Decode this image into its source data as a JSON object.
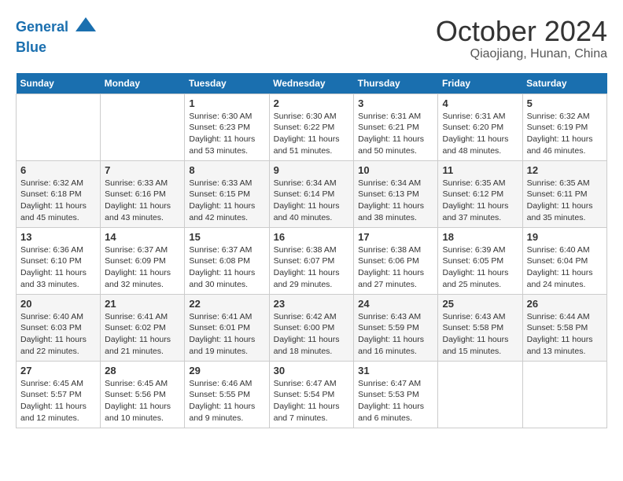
{
  "header": {
    "logo_line1": "General",
    "logo_line2": "Blue",
    "month": "October 2024",
    "location": "Qiaojiang, Hunan, China"
  },
  "days_of_week": [
    "Sunday",
    "Monday",
    "Tuesday",
    "Wednesday",
    "Thursday",
    "Friday",
    "Saturday"
  ],
  "weeks": [
    [
      {
        "day": "",
        "info": ""
      },
      {
        "day": "",
        "info": ""
      },
      {
        "day": "1",
        "info": "Sunrise: 6:30 AM\nSunset: 6:23 PM\nDaylight: 11 hours and 53 minutes."
      },
      {
        "day": "2",
        "info": "Sunrise: 6:30 AM\nSunset: 6:22 PM\nDaylight: 11 hours and 51 minutes."
      },
      {
        "day": "3",
        "info": "Sunrise: 6:31 AM\nSunset: 6:21 PM\nDaylight: 11 hours and 50 minutes."
      },
      {
        "day": "4",
        "info": "Sunrise: 6:31 AM\nSunset: 6:20 PM\nDaylight: 11 hours and 48 minutes."
      },
      {
        "day": "5",
        "info": "Sunrise: 6:32 AM\nSunset: 6:19 PM\nDaylight: 11 hours and 46 minutes."
      }
    ],
    [
      {
        "day": "6",
        "info": "Sunrise: 6:32 AM\nSunset: 6:18 PM\nDaylight: 11 hours and 45 minutes."
      },
      {
        "day": "7",
        "info": "Sunrise: 6:33 AM\nSunset: 6:16 PM\nDaylight: 11 hours and 43 minutes."
      },
      {
        "day": "8",
        "info": "Sunrise: 6:33 AM\nSunset: 6:15 PM\nDaylight: 11 hours and 42 minutes."
      },
      {
        "day": "9",
        "info": "Sunrise: 6:34 AM\nSunset: 6:14 PM\nDaylight: 11 hours and 40 minutes."
      },
      {
        "day": "10",
        "info": "Sunrise: 6:34 AM\nSunset: 6:13 PM\nDaylight: 11 hours and 38 minutes."
      },
      {
        "day": "11",
        "info": "Sunrise: 6:35 AM\nSunset: 6:12 PM\nDaylight: 11 hours and 37 minutes."
      },
      {
        "day": "12",
        "info": "Sunrise: 6:35 AM\nSunset: 6:11 PM\nDaylight: 11 hours and 35 minutes."
      }
    ],
    [
      {
        "day": "13",
        "info": "Sunrise: 6:36 AM\nSunset: 6:10 PM\nDaylight: 11 hours and 33 minutes."
      },
      {
        "day": "14",
        "info": "Sunrise: 6:37 AM\nSunset: 6:09 PM\nDaylight: 11 hours and 32 minutes."
      },
      {
        "day": "15",
        "info": "Sunrise: 6:37 AM\nSunset: 6:08 PM\nDaylight: 11 hours and 30 minutes."
      },
      {
        "day": "16",
        "info": "Sunrise: 6:38 AM\nSunset: 6:07 PM\nDaylight: 11 hours and 29 minutes."
      },
      {
        "day": "17",
        "info": "Sunrise: 6:38 AM\nSunset: 6:06 PM\nDaylight: 11 hours and 27 minutes."
      },
      {
        "day": "18",
        "info": "Sunrise: 6:39 AM\nSunset: 6:05 PM\nDaylight: 11 hours and 25 minutes."
      },
      {
        "day": "19",
        "info": "Sunrise: 6:40 AM\nSunset: 6:04 PM\nDaylight: 11 hours and 24 minutes."
      }
    ],
    [
      {
        "day": "20",
        "info": "Sunrise: 6:40 AM\nSunset: 6:03 PM\nDaylight: 11 hours and 22 minutes."
      },
      {
        "day": "21",
        "info": "Sunrise: 6:41 AM\nSunset: 6:02 PM\nDaylight: 11 hours and 21 minutes."
      },
      {
        "day": "22",
        "info": "Sunrise: 6:41 AM\nSunset: 6:01 PM\nDaylight: 11 hours and 19 minutes."
      },
      {
        "day": "23",
        "info": "Sunrise: 6:42 AM\nSunset: 6:00 PM\nDaylight: 11 hours and 18 minutes."
      },
      {
        "day": "24",
        "info": "Sunrise: 6:43 AM\nSunset: 5:59 PM\nDaylight: 11 hours and 16 minutes."
      },
      {
        "day": "25",
        "info": "Sunrise: 6:43 AM\nSunset: 5:58 PM\nDaylight: 11 hours and 15 minutes."
      },
      {
        "day": "26",
        "info": "Sunrise: 6:44 AM\nSunset: 5:58 PM\nDaylight: 11 hours and 13 minutes."
      }
    ],
    [
      {
        "day": "27",
        "info": "Sunrise: 6:45 AM\nSunset: 5:57 PM\nDaylight: 11 hours and 12 minutes."
      },
      {
        "day": "28",
        "info": "Sunrise: 6:45 AM\nSunset: 5:56 PM\nDaylight: 11 hours and 10 minutes."
      },
      {
        "day": "29",
        "info": "Sunrise: 6:46 AM\nSunset: 5:55 PM\nDaylight: 11 hours and 9 minutes."
      },
      {
        "day": "30",
        "info": "Sunrise: 6:47 AM\nSunset: 5:54 PM\nDaylight: 11 hours and 7 minutes."
      },
      {
        "day": "31",
        "info": "Sunrise: 6:47 AM\nSunset: 5:53 PM\nDaylight: 11 hours and 6 minutes."
      },
      {
        "day": "",
        "info": ""
      },
      {
        "day": "",
        "info": ""
      }
    ]
  ]
}
